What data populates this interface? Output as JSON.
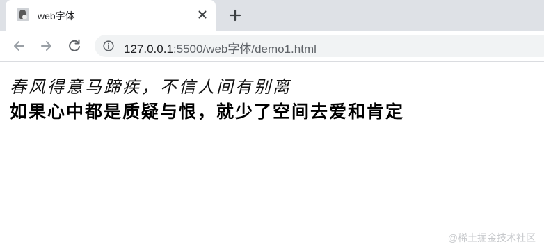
{
  "browser": {
    "tab": {
      "title": "web字体",
      "close_icon": "close-icon",
      "favicon": "avatar-favicon"
    },
    "new_tab_icon": "plus-icon",
    "nav": {
      "back_icon": "arrow-left-icon",
      "forward_icon": "arrow-right-icon",
      "reload_icon": "reload-icon"
    },
    "address": {
      "info_icon": "info-icon",
      "host": "127.0.0.1",
      "path": ":5500/web字体/demo1.html"
    }
  },
  "page": {
    "line1": "春风得意马蹄疾，不信人间有别离",
    "line2": "如果心中都是质疑与恨，就少了空间去爱和肯定"
  },
  "watermark": "@稀土掘金技术社区",
  "colors": {
    "tabstrip": "#dee1e6",
    "omnibox": "#f1f3f4",
    "icon": "#5f6368",
    "text": "#202124"
  }
}
